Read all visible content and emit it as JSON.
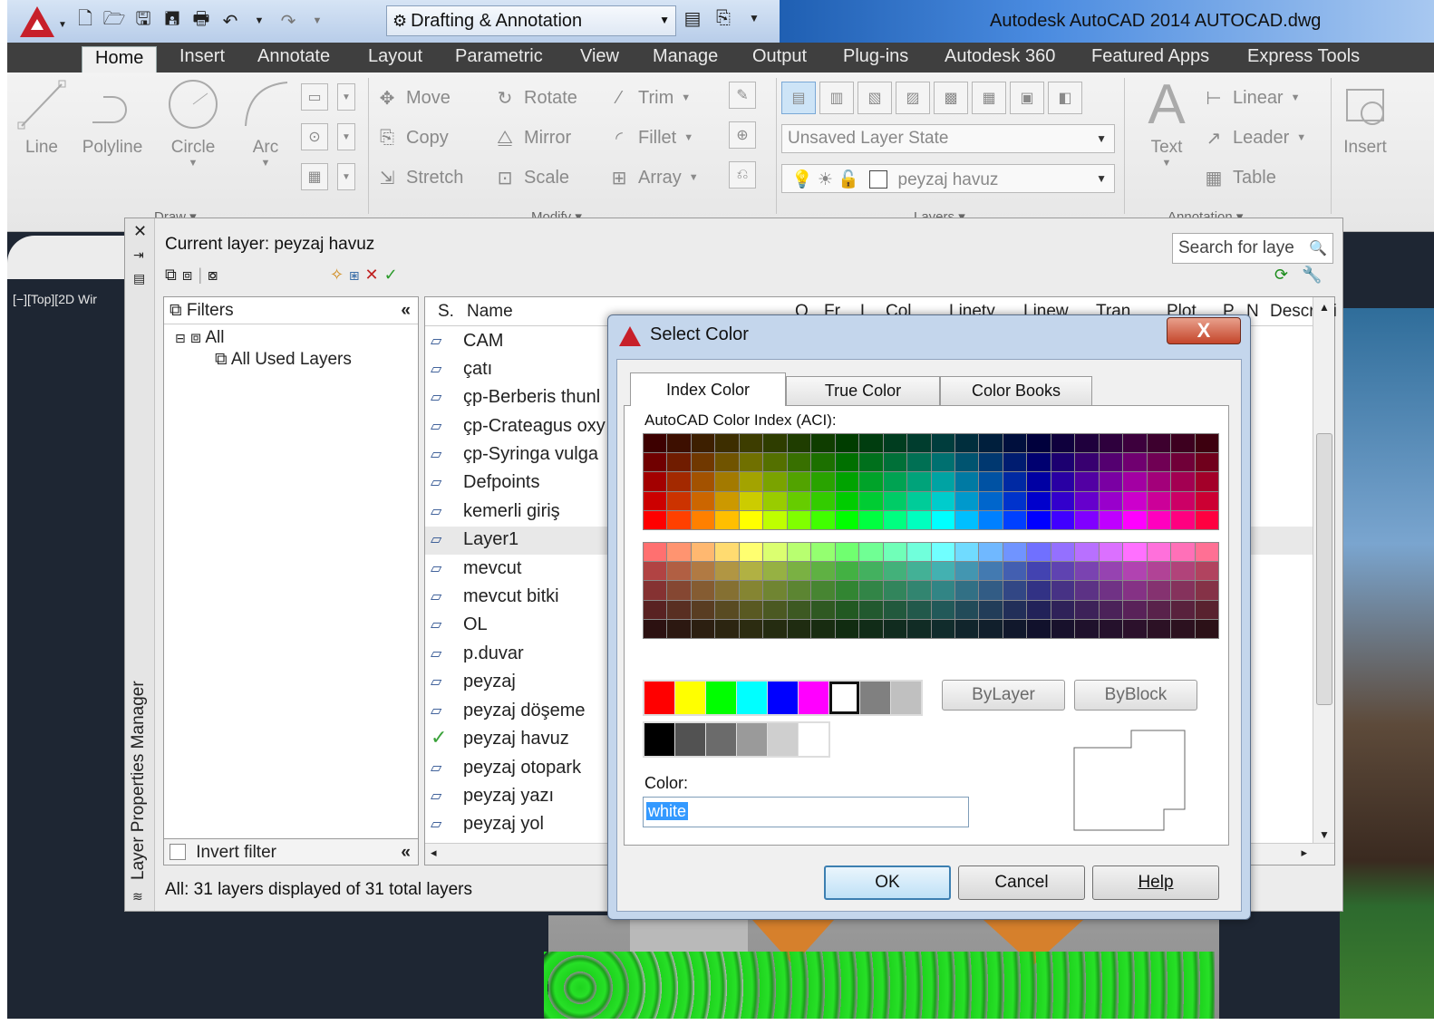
{
  "titlebar": {
    "workspace": "Drafting & Annotation",
    "title": "Autodesk AutoCAD 2014    AUTOCAD.dwg",
    "qat_icons": [
      "new-icon",
      "open-icon",
      "save-icon",
      "save-as-icon",
      "plot-icon",
      "undo-icon",
      "redo-icon"
    ]
  },
  "ribbon_tabs": [
    "Home",
    "Insert",
    "Annotate",
    "Layout",
    "Parametric",
    "View",
    "Manage",
    "Output",
    "Plug-ins",
    "Autodesk 360",
    "Featured Apps",
    "Express Tools"
  ],
  "ribbon": {
    "draw": {
      "line": "Line",
      "polyline": "Polyline",
      "circle": "Circle",
      "arc": "Arc",
      "title": "Draw ▾"
    },
    "modify": {
      "move": "Move",
      "rotate": "Rotate",
      "trim": "Trim",
      "copy": "Copy",
      "mirror": "Mirror",
      "fillet": "Fillet",
      "stretch": "Stretch",
      "scale": "Scale",
      "array": "Array",
      "title": "Modify ▾"
    },
    "layers": {
      "state": "Unsaved Layer State",
      "current": "peyzaj havuz",
      "title": "Layers ▾"
    },
    "annotation": {
      "text": "Text",
      "linear": "Linear",
      "leader": "Leader",
      "table": "Table",
      "title": "Annotation ▾"
    },
    "insert": "Insert"
  },
  "viewport_label": "[−][Top][2D Wir",
  "lpm": {
    "current_layer": "Current layer: peyzaj havuz",
    "search_placeholder": "Search for laye",
    "palette_title": "Layer Properties Manager",
    "filters_header": "Filters",
    "filter_all": "All",
    "filter_used": "All Used Layers",
    "invert_filter": "Invert filter",
    "columns": [
      "S.",
      "Name",
      "O",
      "Fr",
      "L",
      "Col",
      "Linety",
      "Linew",
      "Tran",
      "Plot",
      "P",
      "N",
      "Descripti"
    ],
    "layers": [
      "CAM",
      "çatı",
      "çp-Berberis thunl",
      "çp-Crateagus oxy",
      "çp-Syringa vulga",
      "Defpoints",
      "kemerli giriş",
      "Layer1",
      "mevcut",
      "mevcut bitki",
      "OL",
      "p.duvar",
      "peyzaj",
      "peyzaj döşeme",
      "peyzaj havuz",
      "peyzaj otopark",
      "peyzaj yazı",
      "peyzaj yol"
    ],
    "selected_layer": "Layer1",
    "current_layer_name": "peyzaj havuz",
    "status": "All: 31 layers displayed of 31 total layers"
  },
  "dialog": {
    "title": "Select Color",
    "close": "X",
    "tabs": [
      "Index Color",
      "True Color",
      "Color Books"
    ],
    "active_tab": "Index Color",
    "aci_label": "AutoCAD Color Index (ACI):",
    "bylayer": "ByLayer",
    "byblock": "ByBlock",
    "color_label": "Color:",
    "color_value": "white",
    "ok": "OK",
    "cancel": "Cancel",
    "help": "Help",
    "standard_colors": [
      "#ff0000",
      "#ffff00",
      "#00ff00",
      "#00ffff",
      "#0000ff",
      "#ff00ff",
      "#ffffff",
      "#808080",
      "#c0c0c0"
    ],
    "gray_colors": [
      "#000000",
      "#525252",
      "#6b6b6b",
      "#9a9a9a",
      "#cfcfcf",
      "#ffffff"
    ]
  }
}
